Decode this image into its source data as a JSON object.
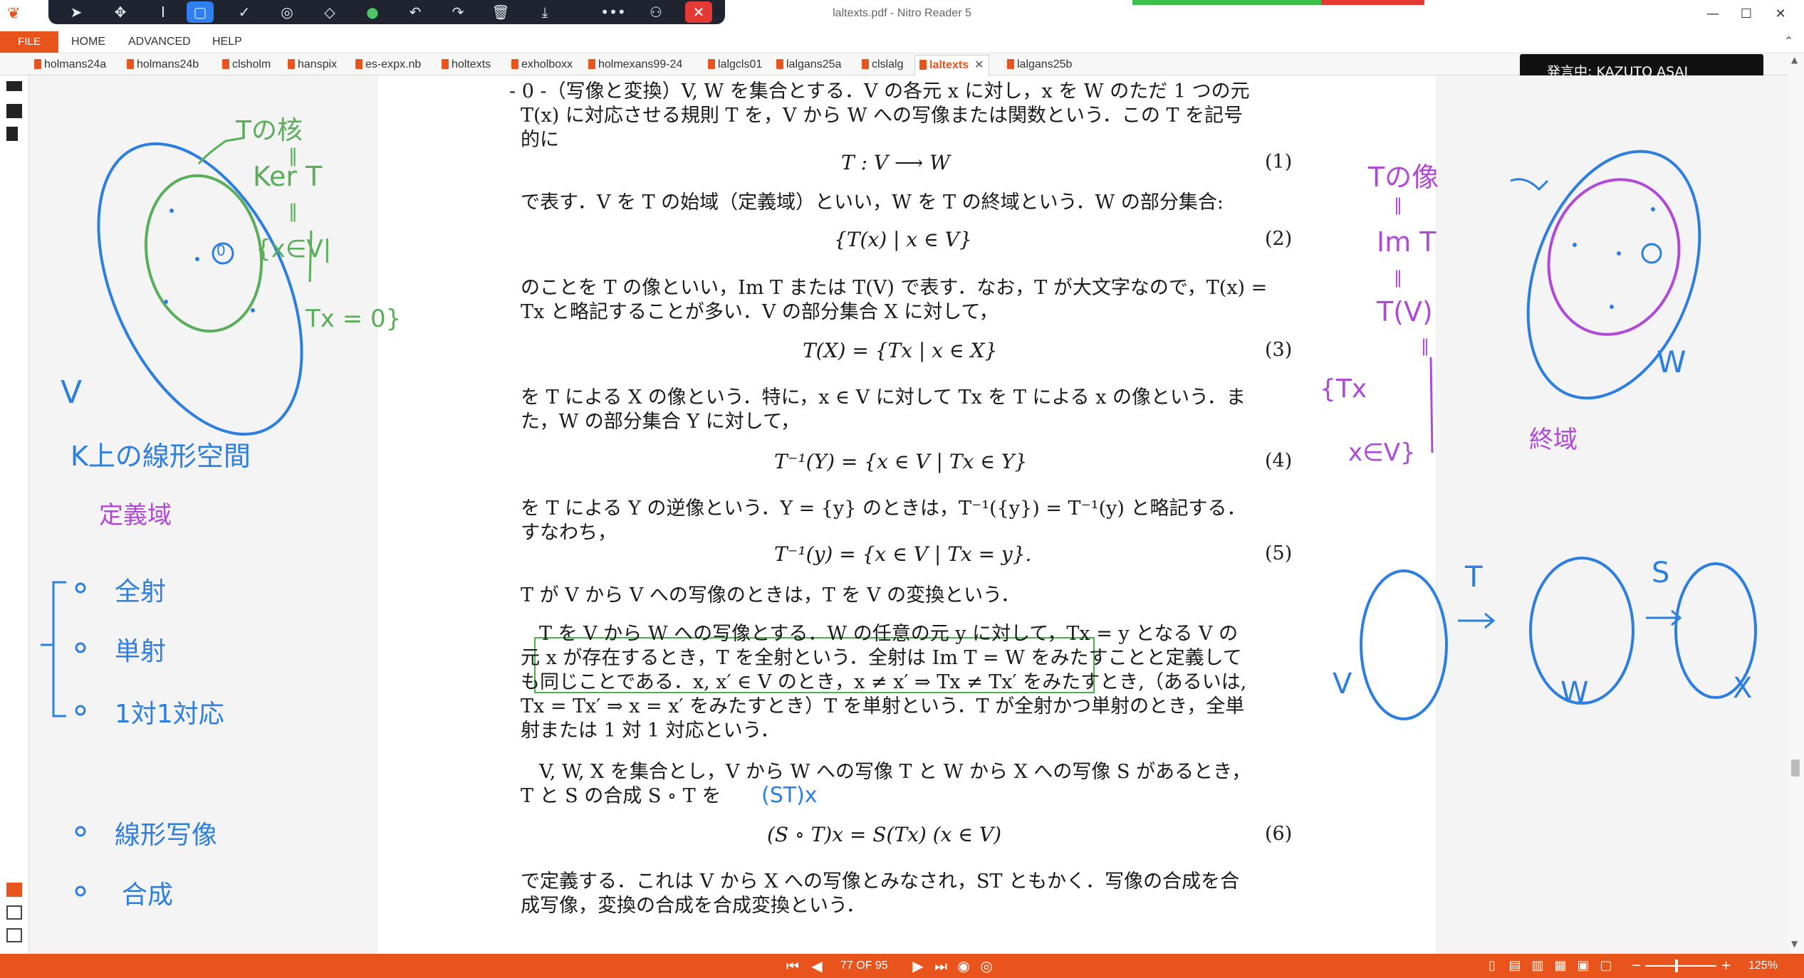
{
  "window": {
    "title": "laltexts.pdf - Nitro Reader 5",
    "controls": [
      "—",
      "☐",
      "✕"
    ]
  },
  "ribbon": {
    "file_label": "FILE",
    "tabs": [
      "HOME",
      "ADVANCED",
      "HELP"
    ]
  },
  "doc_tabs": [
    "holmans24a",
    "holmans24b",
    "clsholm",
    "hanspix",
    "es-expx.nb",
    "holtexts",
    "exholboxx",
    "holmexans99-24",
    "lalgcls01",
    "lalgans25a",
    "clslalg",
    "laltexts",
    "lalgans25b"
  ],
  "active_tab": "laltexts",
  "tab_close": "✕",
  "speaker_label": "発言中: KAZUTO ASAI",
  "colors": {
    "accent": "#e8541b",
    "presence_green": "#3cc24b",
    "presence_red": "#e53935",
    "ink_blue": "#2c7fe0",
    "ink_green": "#5aae5a",
    "ink_purple": "#b04ad6",
    "highlight_box": "#4caf50"
  },
  "page": {
    "para1_line1": "- 0 -（写像と変換）V, W を集合とする．V の各元 x に対し，x を W のただ 1 つの元",
    "para1_line2": "T(x) に対応させる規則 T を，V から W への写像または関数という．この T を記号",
    "para1_line3": "的に",
    "eq1": "T : V ⟶ W",
    "eq1_num": "(1)",
    "para2_line1": "で表す．V を T の始域（定義域）といい，W を T の終域という．W の部分集合:",
    "eq2": "{T(x) | x ∈ V}",
    "eq2_num": "(2)",
    "para3_line1": "のことを T の像といい，Im T または T(V) で表す．なお，T が大文字なので，T(x) =",
    "para3_line2": "Tx と略記することが多い．V の部分集合 X に対して，",
    "eq3": "T(X) = {Tx | x ∈ X}",
    "eq3_num": "(3)",
    "para4_line1": "を T による X の像という．特に，x ∈ V に対して Tx を T による x の像という．ま",
    "para4_line2": "た，W の部分集合 Y に対して，",
    "eq4": "T⁻¹(Y) = {x ∈ V | Tx ∈ Y}",
    "eq4_num": "(4)",
    "para5_line1": "を T による Y の逆像という．Y = {y} のときは，T⁻¹({y}) = T⁻¹(y) と略記する．",
    "para5_line2": "すなわち，",
    "eq5": "T⁻¹(y) = {x ∈ V | Tx = y}.",
    "eq5_num": "(5)",
    "boxed_line": "T が V から V への写像のときは，T を V の変換という．",
    "para6_line1": "T を V から W への写像とする．W の任意の元 y に対して，Tx = y となる V の",
    "para6_line2": "元 x が存在するとき，T を全射という．全射は Im T = W をみたすことと定義して",
    "para6_line3": "も同じことである．x, x′ ∈ V のとき，x ≠ x′ ⇒ Tx ≠ Tx′ をみたすとき,（あるいは,",
    "para6_line4": "Tx = Tx′ ⇒ x = x′ をみたすとき）T を単射という．T が全射かつ単射のとき，全単",
    "para6_line5": "射または 1 対 1 対応という．",
    "para7_line1": "V, W, X を集合とし，V から W への写像 T と W から X への写像 S があるとき，",
    "para7_line2": "T と S の合成 S ∘ T を",
    "eq6": "(S ∘ T)x = S(Tx)        (x ∈ V)",
    "eq6_num": "(6)",
    "para8_line1": "で定義する．これは V から X への写像とみなされ，ST ともかく．写像の合成を合",
    "para8_line2": "成写像，変換の合成を合成変換という．"
  },
  "annotations": {
    "kernel_title": "Tの核",
    "ker_T": "Ker T",
    "kernel_set": "{x∈V|",
    "kernel_cond": "Tx = 0}",
    "dot_zero": "0",
    "V_label": "V",
    "vector_space": "K上の線形空間",
    "domain_word": "定義域",
    "surjective": "全射",
    "injective": "単射",
    "bijective": "1対1対応",
    "linear_map": "線形写像",
    "composition": "合成",
    "image_title": "Tの像",
    "im_T": "Im T",
    "T_V": "T(V)",
    "image_set_left": "{Tx",
    "image_set_bottom": "x∈V}",
    "W_label": "W",
    "codomain_word": "終域",
    "comp_T": "T",
    "comp_S": "S",
    "comp_V": "V",
    "comp_W": "W",
    "comp_X": "X",
    "st_x": "(ST)x"
  },
  "status": {
    "page_indicator": "77 OF 95",
    "zoom": "125%"
  }
}
